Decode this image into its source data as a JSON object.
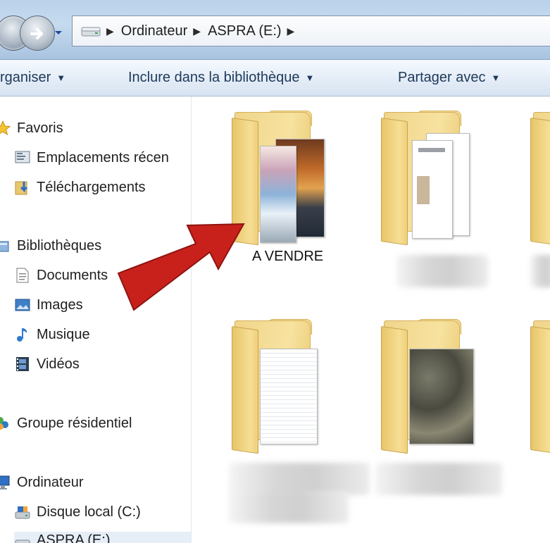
{
  "breadcrumb": {
    "items": [
      "Ordinateur",
      "ASPRA (E:)"
    ]
  },
  "toolbar": {
    "organiser": "rganiser",
    "inclure": "Inclure dans la bibliothèque",
    "partager": "Partager avec"
  },
  "navpane": {
    "favoris": "Favoris",
    "emplacements": "Emplacements récen",
    "telechargements": "Téléchargements",
    "bibliotheques": "Bibliothèques",
    "documents": "Documents",
    "images": "Images",
    "musique": "Musique",
    "videos": "Vidéos",
    "groupe": "Groupe résidentiel",
    "ordinateur": "Ordinateur",
    "disque_local": "Disque local (C:)",
    "aspra": "ASPRA (E:)"
  },
  "content": {
    "folder1_label": "A VENDRE"
  },
  "colors": {
    "arrow": "#c8211b",
    "folder": "#f4dc93",
    "toolbar_text": "#1e395b"
  }
}
